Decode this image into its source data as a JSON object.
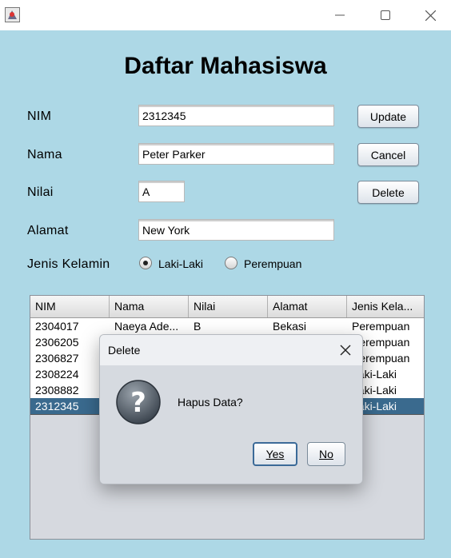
{
  "window": {
    "minimize_symbol": "—",
    "maximize_symbol": "☐",
    "close_symbol": "✕"
  },
  "form": {
    "title": "Daftar Mahasiswa",
    "nim_label": "NIM",
    "nim_value": "2312345",
    "nama_label": "Nama",
    "nama_value": "Peter Parker",
    "nilai_label": "Nilai",
    "nilai_value": "A",
    "alamat_label": "Alamat",
    "alamat_value": "New York",
    "gender_label": "Jenis Kelamin",
    "gender_options": [
      "Laki-Laki",
      "Perempuan"
    ],
    "gender_selected": "Laki-Laki"
  },
  "buttons": {
    "update": "Update",
    "cancel": "Cancel",
    "delete": "Delete"
  },
  "table": {
    "columns": [
      "NIM",
      "Nama",
      "Nilai",
      "Alamat",
      "Jenis Kela..."
    ],
    "rows": [
      [
        "2304017",
        "Naeya Ade...",
        "B",
        "Bekasi",
        "Perempuan"
      ],
      [
        "2306205",
        "",
        "",
        "",
        "Perempuan"
      ],
      [
        "2306827",
        "",
        "",
        "",
        "Perempuan"
      ],
      [
        "2308224",
        "",
        "",
        "",
        "Laki-Laki"
      ],
      [
        "2308882",
        "",
        "",
        "",
        "Laki-Laki"
      ],
      [
        "2312345",
        "",
        "",
        "",
        "Laki-Laki"
      ]
    ],
    "selected_row": 5
  },
  "dialog": {
    "title": "Delete",
    "message": "Hapus Data?",
    "icon": "question-icon",
    "yes_label": "Yes",
    "no_label": "No"
  },
  "colors": {
    "background": "#add8e6",
    "selection": "#3a6a8e",
    "dialog_bg": "#d6dae0"
  }
}
